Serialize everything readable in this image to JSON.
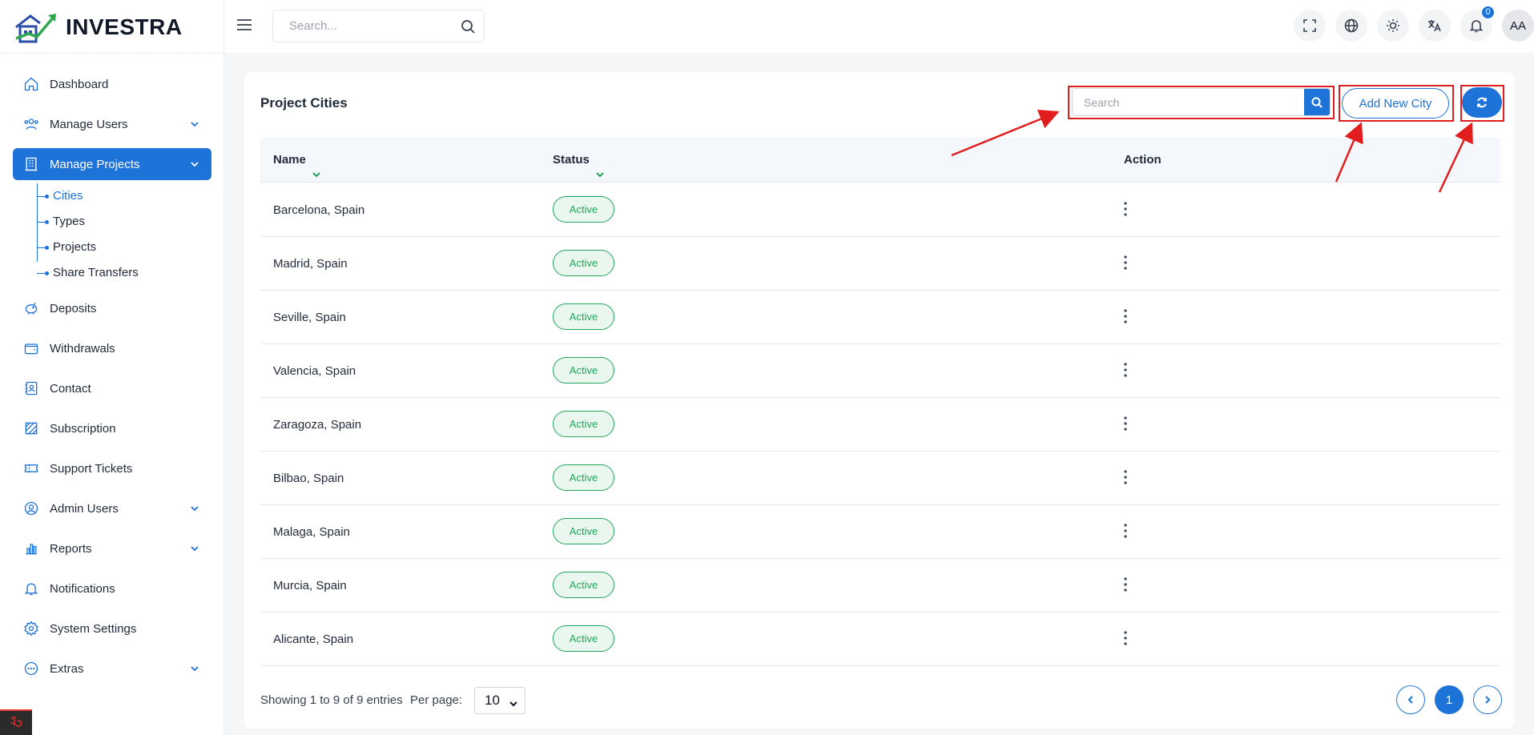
{
  "brand": {
    "name": "INVESTRA"
  },
  "topbar": {
    "search_placeholder": "Search...",
    "notification_count": "0",
    "avatar_initials": "AA",
    "icons": [
      "fullscreen-icon",
      "globe-icon",
      "sun-icon",
      "translate-icon",
      "bell-icon"
    ]
  },
  "sidebar": {
    "items": [
      {
        "label": "Dashboard",
        "icon": "home-icon"
      },
      {
        "label": "Manage Users",
        "icon": "users-icon"
      },
      {
        "label": "Manage Projects",
        "icon": "building-icon"
      },
      {
        "label": "Deposits",
        "icon": "piggy-bank-icon"
      },
      {
        "label": "Withdrawals",
        "icon": "wallet-icon"
      },
      {
        "label": "Contact",
        "icon": "contact-icon"
      },
      {
        "label": "Subscription",
        "icon": "subscription-icon"
      },
      {
        "label": "Support Tickets",
        "icon": "ticket-icon"
      },
      {
        "label": "Admin Users",
        "icon": "admin-user-icon"
      },
      {
        "label": "Reports",
        "icon": "chart-icon"
      },
      {
        "label": "Notifications",
        "icon": "bell-icon"
      },
      {
        "label": "System Settings",
        "icon": "gear-icon"
      },
      {
        "label": "Extras",
        "icon": "more-icon"
      }
    ],
    "submenu": [
      "Cities",
      "Types",
      "Projects",
      "Share Transfers"
    ]
  },
  "main": {
    "title": "Project Cities",
    "search_placeholder": "Search",
    "add_button": "Add New City",
    "columns": {
      "name": "Name",
      "status": "Status",
      "action": "Action"
    },
    "rows": [
      {
        "name": "Barcelona, Spain",
        "status": "Active"
      },
      {
        "name": "Madrid, Spain",
        "status": "Active"
      },
      {
        "name": "Seville, Spain",
        "status": "Active"
      },
      {
        "name": "Valencia, Spain",
        "status": "Active"
      },
      {
        "name": "Zaragoza, Spain",
        "status": "Active"
      },
      {
        "name": "Bilbao, Spain",
        "status": "Active"
      },
      {
        "name": "Malaga, Spain",
        "status": "Active"
      },
      {
        "name": "Murcia, Spain",
        "status": "Active"
      },
      {
        "name": "Alicante, Spain",
        "status": "Active"
      }
    ],
    "footer": {
      "entries_text": "Showing 1 to 9 of 9 entries",
      "per_page_label": "Per page:",
      "per_page_value": "10",
      "current_page": "1"
    }
  },
  "colors": {
    "accent": "#1e73d9",
    "active_status": "#22a55b",
    "highlight": "#e11d1d"
  }
}
